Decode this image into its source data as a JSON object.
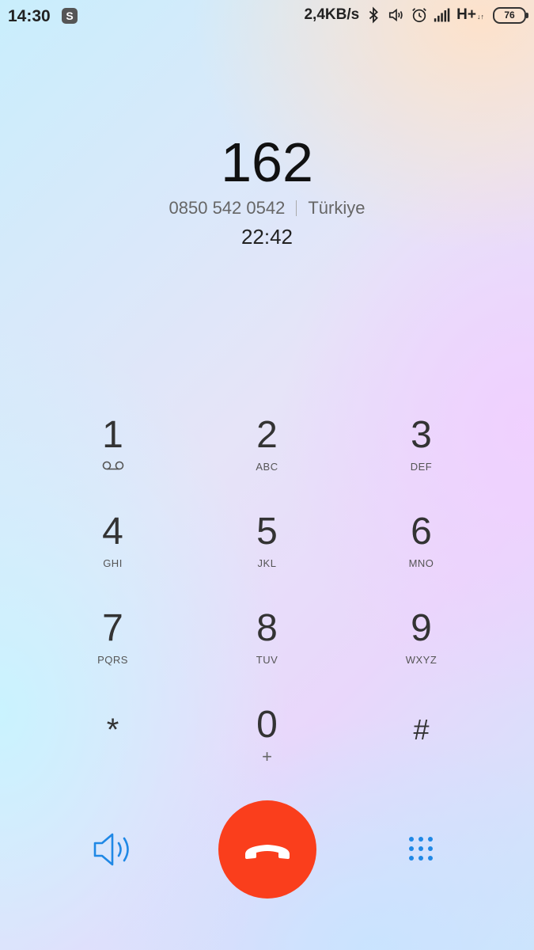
{
  "status_bar": {
    "time": "14:30",
    "app_badge": "S",
    "net_speed": "2,4KB/s",
    "network_type": "H+",
    "network_sub": "↓↑",
    "battery": "76",
    "icons": [
      "bluetooth-icon",
      "vibrate-icon",
      "alarm-icon",
      "signal-icon"
    ]
  },
  "call": {
    "name": "162",
    "number": "0850 542 0542",
    "location": "Türkiye",
    "duration": "22:42"
  },
  "keypad": {
    "keys": [
      {
        "digit": "1",
        "letters": ""
      },
      {
        "digit": "2",
        "letters": "ABC"
      },
      {
        "digit": "3",
        "letters": "DEF"
      },
      {
        "digit": "4",
        "letters": "GHI"
      },
      {
        "digit": "5",
        "letters": "JKL"
      },
      {
        "digit": "6",
        "letters": "MNO"
      },
      {
        "digit": "7",
        "letters": "PQRS"
      },
      {
        "digit": "8",
        "letters": "TUV"
      },
      {
        "digit": "9",
        "letters": "WXYZ"
      },
      {
        "digit": "*",
        "letters": ""
      },
      {
        "digit": "0",
        "letters": "+"
      },
      {
        "digit": "#",
        "letters": ""
      }
    ]
  },
  "controls": {
    "speaker_icon": "speaker-icon",
    "end_call_icon": "end-call-icon",
    "dialpad_icon": "dialpad-icon",
    "end_call_color": "#fa3e1c",
    "accent_color": "#1f88e5"
  }
}
